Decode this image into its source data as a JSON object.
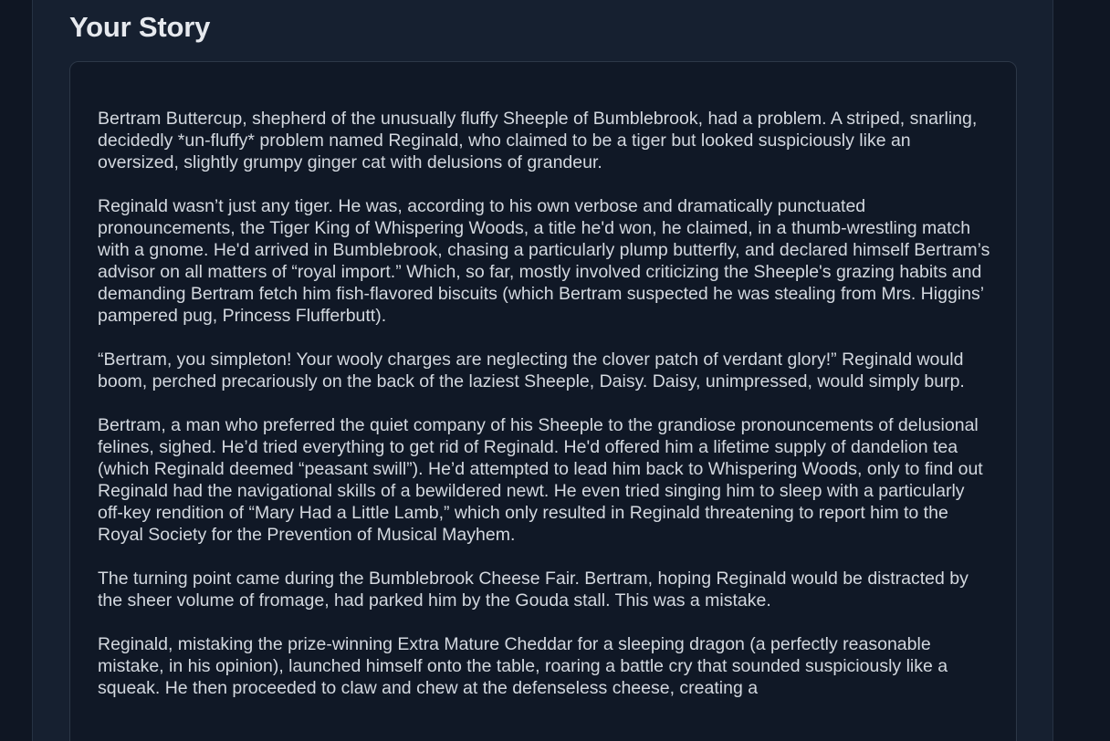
{
  "header": {
    "title": "Your Story"
  },
  "story": {
    "paragraphs": [
      "Bertram Buttercup, shepherd of the unusually fluffy Sheeple of Bumblebrook, had a problem. A striped, snarling, decidedly *un-fluffy* problem named Reginald, who claimed to be a tiger but looked suspiciously like an oversized, slightly grumpy ginger cat with delusions of grandeur.",
      "Reginald wasn’t just any tiger. He was, according to his own verbose and dramatically punctuated pronouncements, the Tiger King of Whispering Woods, a title he'd won, he claimed, in a thumb-wrestling match with a gnome. He'd arrived in Bumblebrook, chasing a particularly plump butterfly, and declared himself Bertram’s advisor on all matters of “royal import.” Which, so far, mostly involved criticizing the Sheeple's grazing habits and demanding Bertram fetch him fish-flavored biscuits (which Bertram suspected he was stealing from Mrs. Higgins’ pampered pug, Princess Flufferbutt).",
      "“Bertram, you simpleton! Your wooly charges are neglecting the clover patch of verdant glory!” Reginald would boom, perched precariously on the back of the laziest Sheeple, Daisy. Daisy, unimpressed, would simply burp.",
      "Bertram, a man who preferred the quiet company of his Sheeple to the grandiose pronouncements of delusional felines, sighed. He’d tried everything to get rid of Reginald. He'd offered him a lifetime supply of dandelion tea (which Reginald deemed “peasant swill”). He’d attempted to lead him back to Whispering Woods, only to find out Reginald had the navigational skills of a bewildered newt. He even tried singing him to sleep with a particularly off-key rendition of “Mary Had a Little Lamb,” which only resulted in Reginald threatening to report him to the Royal Society for the Prevention of Musical Mayhem.",
      "The turning point came during the Bumblebrook Cheese Fair. Bertram, hoping Reginald would be distracted by the sheer volume of fromage, had parked him by the Gouda stall. This was a mistake.",
      "Reginald, mistaking the prize-winning Extra Mature Cheddar for a sleeping dragon (a perfectly reasonable mistake, in his opinion), launched himself onto the table, roaring a battle cry that sounded suspiciously like a squeak. He then proceeded to claw and chew at the defenseless cheese, creating a"
    ]
  }
}
